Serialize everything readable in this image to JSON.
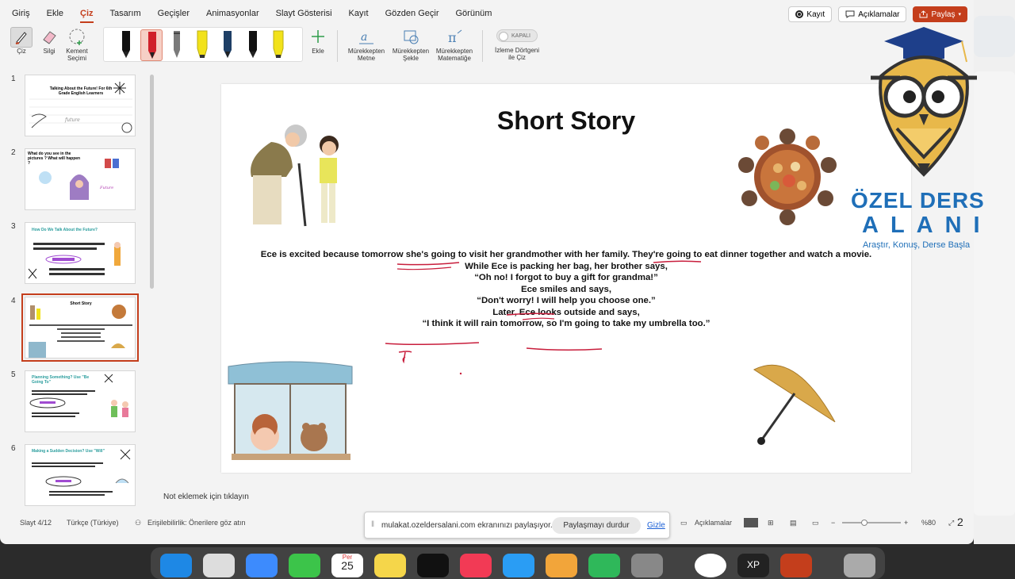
{
  "menu": {
    "items": [
      "Giriş",
      "Ekle",
      "Çiz",
      "Tasarım",
      "Geçişler",
      "Animasyonlar",
      "Slayt Gösterisi",
      "Kayıt",
      "Gözden Geçir",
      "Görünüm"
    ],
    "active_index": 2,
    "record_label": "Kayıt",
    "comments_label": "Açıklamalar",
    "share_label": "Paylaş"
  },
  "ribbon": {
    "draw_label": "Çiz",
    "eraser_label": "Silgi",
    "lasso_label": "Kement Seçimi",
    "add_label": "Ekle",
    "ink_to_text_label": "Mürekkepten Metne",
    "ink_to_shape_label": "Mürekkepten Şekle",
    "ink_to_math_label": "Mürekkepten Matematiğe",
    "toggle_state": "KAPALI",
    "draw_rect_label": "İzleme Dörtgeni ile Çiz",
    "pen_colors": [
      "#111111",
      "#d0202a",
      "#666666",
      "#f2e21a",
      "#1e3f66",
      "#111111",
      "#f2e21a"
    ]
  },
  "thumbnails": [
    {
      "num": "1",
      "title": "Talking About the Future! For 6th Grade English Learners"
    },
    {
      "num": "2",
      "title": "What do you see in the pictures ? What will happen ?"
    },
    {
      "num": "3",
      "title": "How Do We Talk About the Future?"
    },
    {
      "num": "4",
      "title": "Short Story"
    },
    {
      "num": "5",
      "title": "Planning Something? Use \"Be Going To\""
    },
    {
      "num": "6",
      "title": "Making a Sudden Decision? Use \"Will\""
    }
  ],
  "slide": {
    "title": "Short Story",
    "story_lines": [
      "Ece is excited because tomorrow she's going to visit her grandmother with her family. They're going to eat dinner together and watch a movie.",
      "While Ece is packing her bag, her brother says,",
      "“Oh no! I forgot to buy a gift for grandma!”",
      "Ece smiles and says,",
      "“Don't worry! I will help you choose one.”",
      "Later, Ece looks outside and says,",
      "“I think it will rain tomorrow, so I'm going to take my umbrella too.”"
    ]
  },
  "notes_placeholder": "Not eklemek için tıklayın",
  "status": {
    "slide_info": "Slayt 4/12",
    "language": "Türkçe (Türkiye)",
    "accessibility": "Erişilebilirlik: Önerilere göz atın",
    "comments": "Açıklamalar",
    "zoom": "%80",
    "page_badge": "2"
  },
  "share_bar": {
    "message": "mulakat.ozeldersalani.com ekranınızı paylaşıyor.",
    "stop_label": "Paylaşmayı durdur",
    "hide_label": "Gizle"
  },
  "logo": {
    "line1": "ÖZEL DERS",
    "line2": "ALANI",
    "tagline": "Araştır, Konuş, Derse Başla"
  },
  "dock": {
    "calendar_month": "Per",
    "calendar_day": "25",
    "xp_label": "XP"
  }
}
